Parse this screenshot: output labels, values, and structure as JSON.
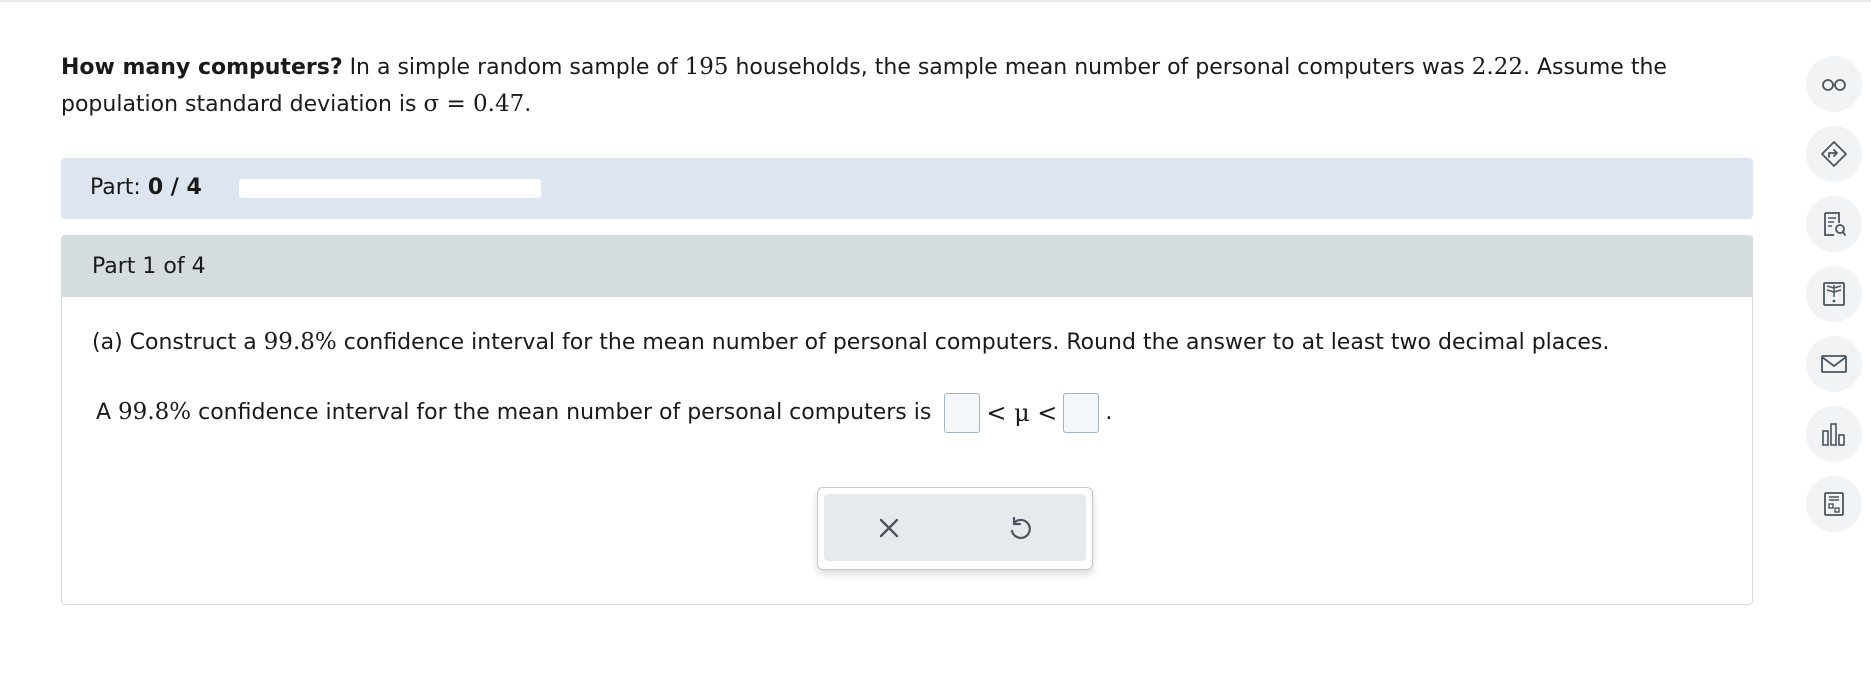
{
  "problem": {
    "title": "How many computers?",
    "text_1": " In a simple random sample of ",
    "n": "195",
    "text_2": " households, the sample mean number of personal computers was ",
    "mean": "2.22",
    "text_3": ". Assume the population standard deviation is ",
    "sigma": "σ = 0.47",
    "text_4": "."
  },
  "part_bar": {
    "label": "Part:",
    "progress": "0 / 4",
    "progress_fraction": 0
  },
  "section": {
    "header": "Part 1 of 4",
    "question_pre": "(a) Construct a ",
    "confidence": "99.8%",
    "question_post": " confidence interval for the mean number of personal computers. Round the answer to at least two decimal places.",
    "answer_pre": "A ",
    "answer_conf": "99.8%",
    "answer_post": " confidence interval for the mean number of personal computers is",
    "lower_value": "",
    "upper_value": "",
    "relation": "< μ <",
    "period": "."
  },
  "tools": {
    "clear_icon": "x-icon",
    "undo_icon": "undo-icon"
  },
  "side_rail": {
    "icons": [
      "glasses-icon",
      "directions-icon",
      "notes-search-icon",
      "textbook-icon",
      "mail-icon",
      "bar-chart-icon",
      "calculator-report-icon"
    ]
  },
  "colors": {
    "part_bar_bg": "#dde6f0",
    "section_header_bg": "#d4dcdf",
    "icon_color": "#4a5560"
  }
}
